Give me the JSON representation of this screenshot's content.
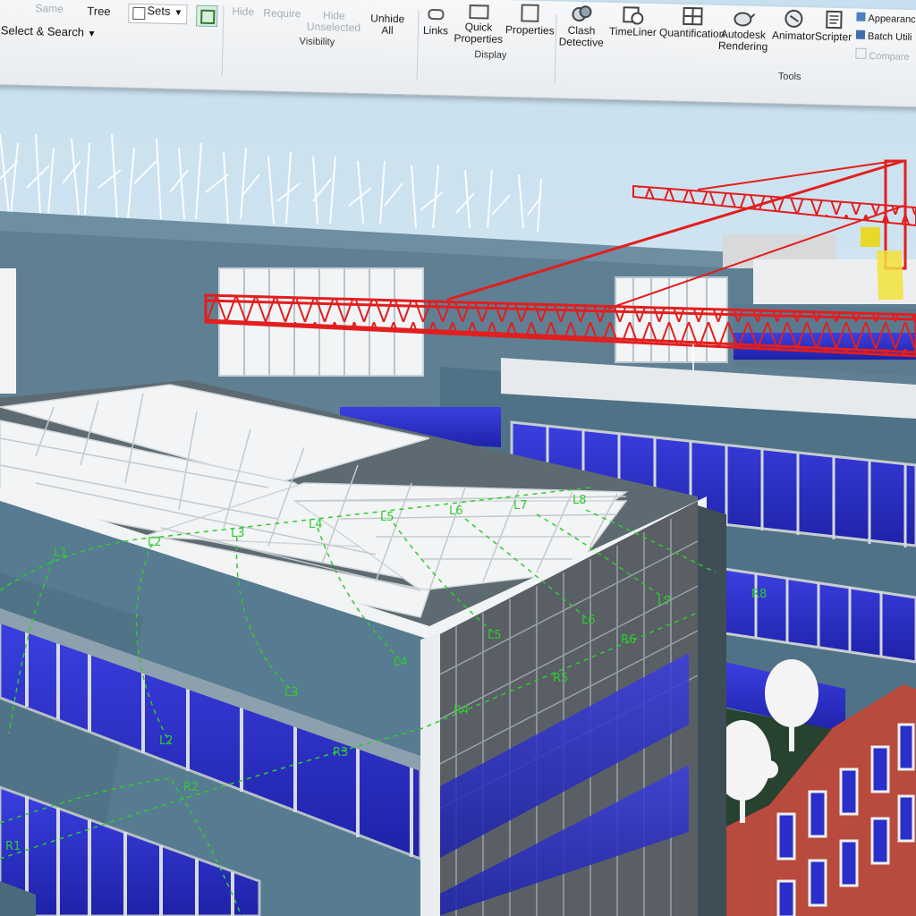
{
  "ribbon": {
    "select_group": {
      "same_label": "Same",
      "tree_label": "Tree",
      "sets_label": "Sets",
      "group_label": "Select & Search"
    },
    "visibility_group": {
      "hide_label": "Hide",
      "require_label": "Require",
      "hide_unselected_label": "Hide Unselected",
      "unhide_all_label": "Unhide All",
      "group_label": "Visibility"
    },
    "display_group": {
      "links_label": "Links",
      "quick_properties_label": "Quick Properties",
      "properties_label": "Properties",
      "group_label": "Display"
    },
    "tools_group": {
      "clash_detective_label": "Clash Detective",
      "timeliner_label": "TimeLiner",
      "quantification_label": "Quantification",
      "autodesk_rendering_label": "Autodesk Rendering",
      "animator_label": "Animator",
      "scripter_label": "Scripter",
      "appearance_label": "Appearanc",
      "batch_utility_label": "Batch Utili",
      "compare_label": "Compare",
      "group_label": "Tools"
    }
  },
  "scene": {
    "lines": [
      "L1",
      "L2",
      "L3",
      "L4",
      "L5",
      "L6",
      "L7",
      "L8"
    ],
    "bottom_labels": [
      "L1",
      "L2",
      "L3",
      "L4",
      "L5",
      "L6",
      "L7"
    ],
    "r_labels": [
      "R1",
      "R2",
      "R3",
      "R4",
      "R5",
      "R6",
      "R8"
    ],
    "colors": {
      "sky": "#cfe3ee",
      "crane": "#e21e1e",
      "glass": "#2b2fc9",
      "facade": "#4d7289",
      "wall_light": "#6f8fa3",
      "brick": "#b84a3e",
      "grid": "#2ecc2e"
    }
  }
}
